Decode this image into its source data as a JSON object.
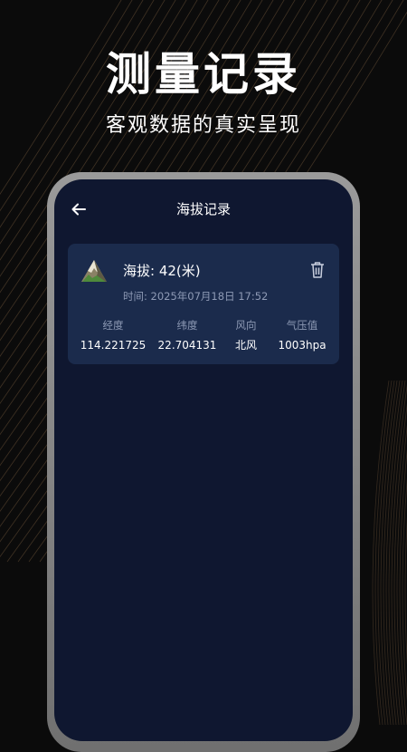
{
  "promo": {
    "title": "测量记录",
    "subtitle": "客观数据的真实呈现"
  },
  "header": {
    "title": "海拔记录",
    "back_icon": "arrow-left-icon"
  },
  "records": [
    {
      "altitude_text": "海拔: 42(米)",
      "time_text": "时间: 2025年07月18日 17:52",
      "icon": "mountain-icon",
      "delete_icon": "trash-icon",
      "stats": [
        {
          "label": "经度",
          "value": "114.221725"
        },
        {
          "label": "纬度",
          "value": "22.704131"
        },
        {
          "label": "风向",
          "value": "北风"
        },
        {
          "label": "气压值",
          "value": "1003hpa"
        }
      ]
    }
  ],
  "colors": {
    "background": "#0b0b0b",
    "screen": "#0f1730",
    "card": "#1b2b4c",
    "muted_text": "#8e9ab5",
    "accent_lines": "#6b5238"
  }
}
